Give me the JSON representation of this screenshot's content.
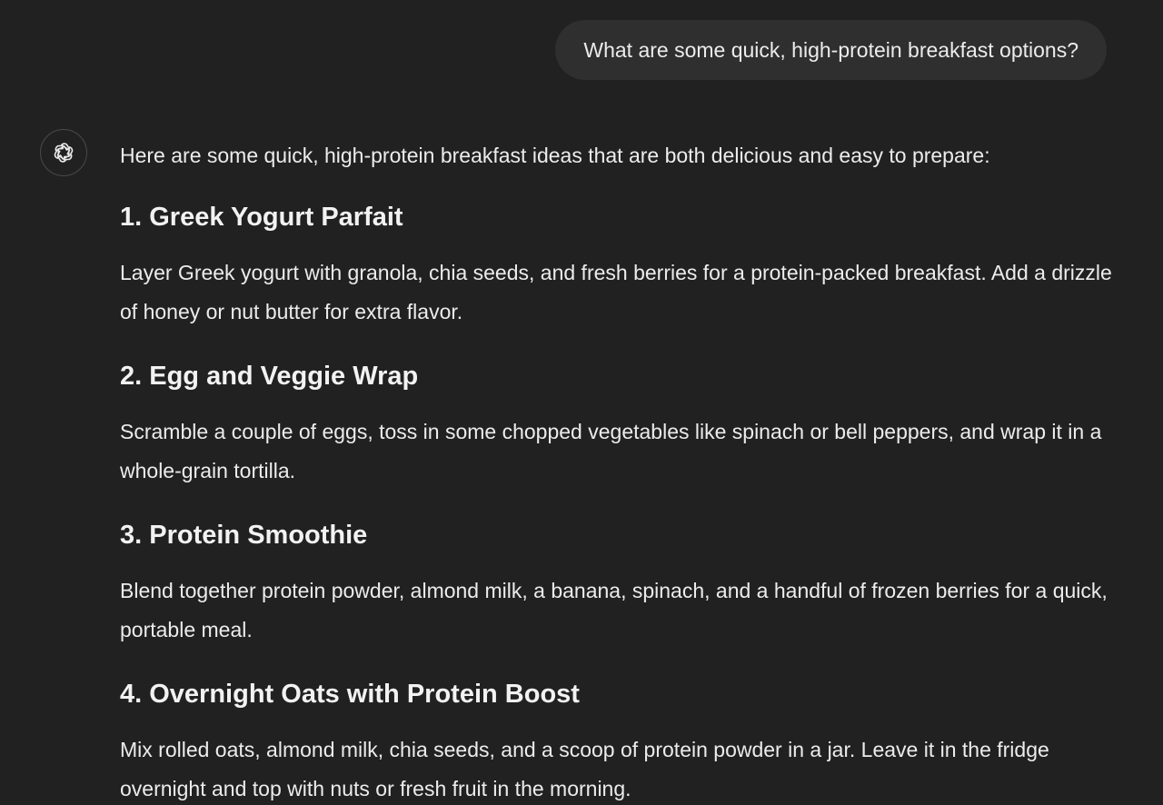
{
  "user_message": {
    "text": "What are some quick, high-protein breakfast options?"
  },
  "assistant": {
    "avatar_icon": "openai-logo-icon",
    "intro": "Here are some quick, high-protein breakfast ideas that are both delicious and easy to prepare:",
    "options": [
      {
        "heading": "1. Greek Yogurt Parfait",
        "text": "Layer Greek yogurt with granola, chia seeds, and fresh berries for a protein-packed breakfast. Add a drizzle of honey or nut butter for extra flavor."
      },
      {
        "heading": "2. Egg and Veggie Wrap",
        "text": "Scramble a couple of eggs, toss in some chopped vegetables like spinach or bell peppers, and wrap it in a whole-grain tortilla."
      },
      {
        "heading": "3. Protein Smoothie",
        "text": "Blend together protein powder, almond milk, a banana, spinach, and a handful of frozen berries for a quick, portable meal."
      },
      {
        "heading": "4. Overnight Oats with Protein Boost",
        "text": "Mix rolled oats, almond milk, chia seeds, and a scoop of protein powder in a jar. Leave it in the fridge overnight and top with nuts or fresh fruit in the morning."
      }
    ]
  },
  "colors": {
    "background": "#212121",
    "user_bubble": "#2f2f2f",
    "text": "#ececec"
  }
}
